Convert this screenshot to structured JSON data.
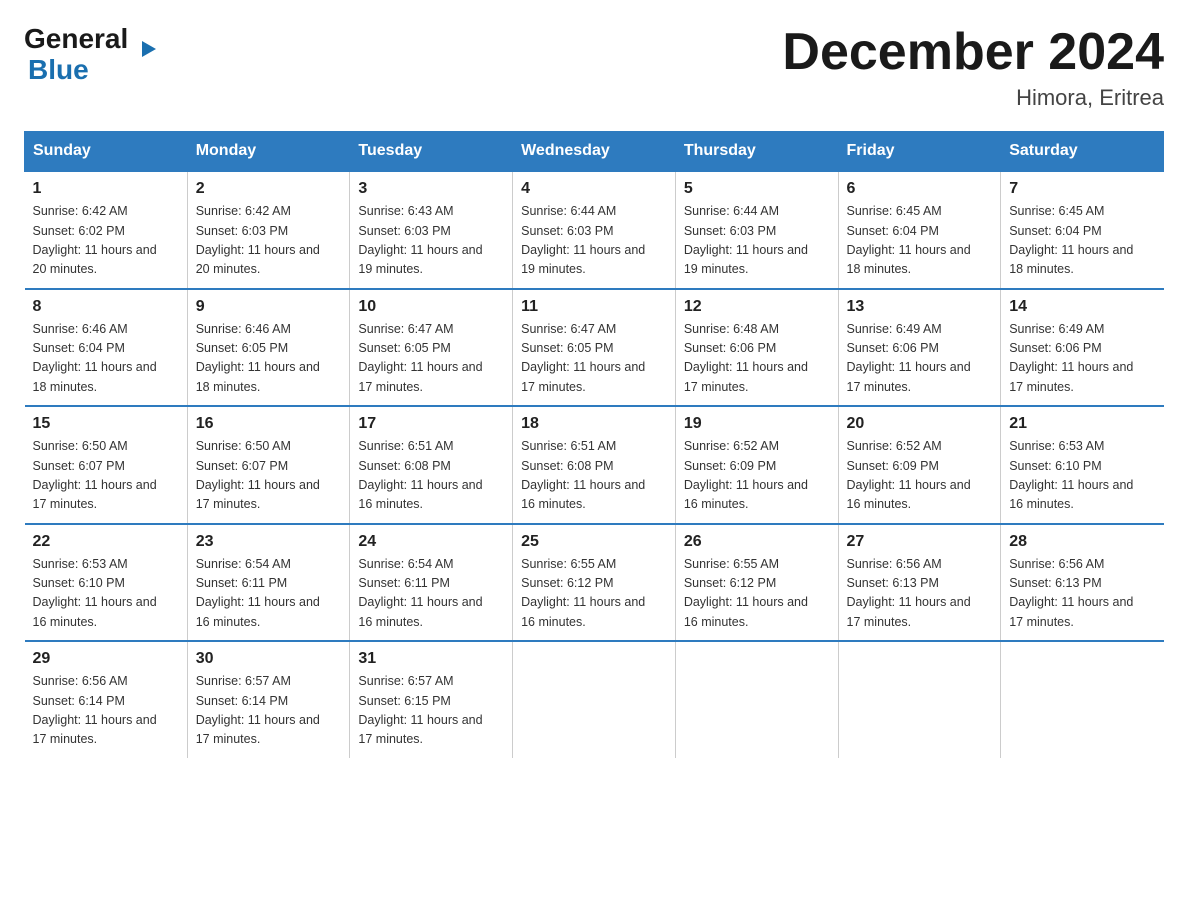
{
  "logo": {
    "general": "General",
    "blue": "Blue"
  },
  "title": "December 2024",
  "location": "Himora, Eritrea",
  "headers": [
    "Sunday",
    "Monday",
    "Tuesday",
    "Wednesday",
    "Thursday",
    "Friday",
    "Saturday"
  ],
  "weeks": [
    [
      {
        "day": "1",
        "sunrise": "6:42 AM",
        "sunset": "6:02 PM",
        "daylight": "11 hours and 20 minutes."
      },
      {
        "day": "2",
        "sunrise": "6:42 AM",
        "sunset": "6:03 PM",
        "daylight": "11 hours and 20 minutes."
      },
      {
        "day": "3",
        "sunrise": "6:43 AM",
        "sunset": "6:03 PM",
        "daylight": "11 hours and 19 minutes."
      },
      {
        "day": "4",
        "sunrise": "6:44 AM",
        "sunset": "6:03 PM",
        "daylight": "11 hours and 19 minutes."
      },
      {
        "day": "5",
        "sunrise": "6:44 AM",
        "sunset": "6:03 PM",
        "daylight": "11 hours and 19 minutes."
      },
      {
        "day": "6",
        "sunrise": "6:45 AM",
        "sunset": "6:04 PM",
        "daylight": "11 hours and 18 minutes."
      },
      {
        "day": "7",
        "sunrise": "6:45 AM",
        "sunset": "6:04 PM",
        "daylight": "11 hours and 18 minutes."
      }
    ],
    [
      {
        "day": "8",
        "sunrise": "6:46 AM",
        "sunset": "6:04 PM",
        "daylight": "11 hours and 18 minutes."
      },
      {
        "day": "9",
        "sunrise": "6:46 AM",
        "sunset": "6:05 PM",
        "daylight": "11 hours and 18 minutes."
      },
      {
        "day": "10",
        "sunrise": "6:47 AM",
        "sunset": "6:05 PM",
        "daylight": "11 hours and 17 minutes."
      },
      {
        "day": "11",
        "sunrise": "6:47 AM",
        "sunset": "6:05 PM",
        "daylight": "11 hours and 17 minutes."
      },
      {
        "day": "12",
        "sunrise": "6:48 AM",
        "sunset": "6:06 PM",
        "daylight": "11 hours and 17 minutes."
      },
      {
        "day": "13",
        "sunrise": "6:49 AM",
        "sunset": "6:06 PM",
        "daylight": "11 hours and 17 minutes."
      },
      {
        "day": "14",
        "sunrise": "6:49 AM",
        "sunset": "6:06 PM",
        "daylight": "11 hours and 17 minutes."
      }
    ],
    [
      {
        "day": "15",
        "sunrise": "6:50 AM",
        "sunset": "6:07 PM",
        "daylight": "11 hours and 17 minutes."
      },
      {
        "day": "16",
        "sunrise": "6:50 AM",
        "sunset": "6:07 PM",
        "daylight": "11 hours and 17 minutes."
      },
      {
        "day": "17",
        "sunrise": "6:51 AM",
        "sunset": "6:08 PM",
        "daylight": "11 hours and 16 minutes."
      },
      {
        "day": "18",
        "sunrise": "6:51 AM",
        "sunset": "6:08 PM",
        "daylight": "11 hours and 16 minutes."
      },
      {
        "day": "19",
        "sunrise": "6:52 AM",
        "sunset": "6:09 PM",
        "daylight": "11 hours and 16 minutes."
      },
      {
        "day": "20",
        "sunrise": "6:52 AM",
        "sunset": "6:09 PM",
        "daylight": "11 hours and 16 minutes."
      },
      {
        "day": "21",
        "sunrise": "6:53 AM",
        "sunset": "6:10 PM",
        "daylight": "11 hours and 16 minutes."
      }
    ],
    [
      {
        "day": "22",
        "sunrise": "6:53 AM",
        "sunset": "6:10 PM",
        "daylight": "11 hours and 16 minutes."
      },
      {
        "day": "23",
        "sunrise": "6:54 AM",
        "sunset": "6:11 PM",
        "daylight": "11 hours and 16 minutes."
      },
      {
        "day": "24",
        "sunrise": "6:54 AM",
        "sunset": "6:11 PM",
        "daylight": "11 hours and 16 minutes."
      },
      {
        "day": "25",
        "sunrise": "6:55 AM",
        "sunset": "6:12 PM",
        "daylight": "11 hours and 16 minutes."
      },
      {
        "day": "26",
        "sunrise": "6:55 AM",
        "sunset": "6:12 PM",
        "daylight": "11 hours and 16 minutes."
      },
      {
        "day": "27",
        "sunrise": "6:56 AM",
        "sunset": "6:13 PM",
        "daylight": "11 hours and 17 minutes."
      },
      {
        "day": "28",
        "sunrise": "6:56 AM",
        "sunset": "6:13 PM",
        "daylight": "11 hours and 17 minutes."
      }
    ],
    [
      {
        "day": "29",
        "sunrise": "6:56 AM",
        "sunset": "6:14 PM",
        "daylight": "11 hours and 17 minutes."
      },
      {
        "day": "30",
        "sunrise": "6:57 AM",
        "sunset": "6:14 PM",
        "daylight": "11 hours and 17 minutes."
      },
      {
        "day": "31",
        "sunrise": "6:57 AM",
        "sunset": "6:15 PM",
        "daylight": "11 hours and 17 minutes."
      },
      null,
      null,
      null,
      null
    ]
  ]
}
